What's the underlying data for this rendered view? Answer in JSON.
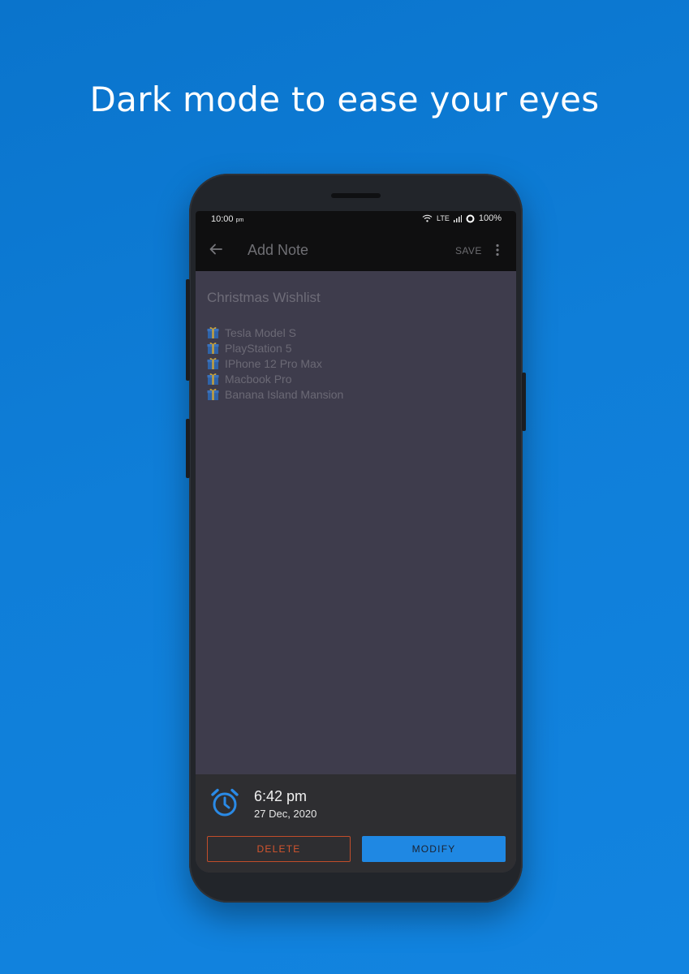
{
  "headline": "Dark mode to ease your eyes",
  "colors": {
    "background": "#0d7bd6",
    "screen_bg": "#3e3c4c",
    "accent": "#1f88e3",
    "delete": "#c24d2a"
  },
  "status_bar": {
    "time": "10:00",
    "time_suffix": "pm",
    "network": "LTE",
    "battery": "100%"
  },
  "toolbar": {
    "back_icon": "arrow-left-icon",
    "title": "Add Note",
    "save_label": "SAVE",
    "more_icon": "more-vertical-icon"
  },
  "note": {
    "title": "Christmas Wishlist",
    "item_icon": "gift-icon",
    "items": [
      "Tesla Model S",
      "PlayStation 5",
      "IPhone 12 Pro Max",
      "Macbook Pro",
      "Banana Island Mansion"
    ]
  },
  "reminder": {
    "icon": "alarm-clock-icon",
    "time": "6:42 pm",
    "date": "27 Dec, 2020"
  },
  "actions": {
    "delete_label": "DELETE",
    "modify_label": "MODIFY"
  }
}
